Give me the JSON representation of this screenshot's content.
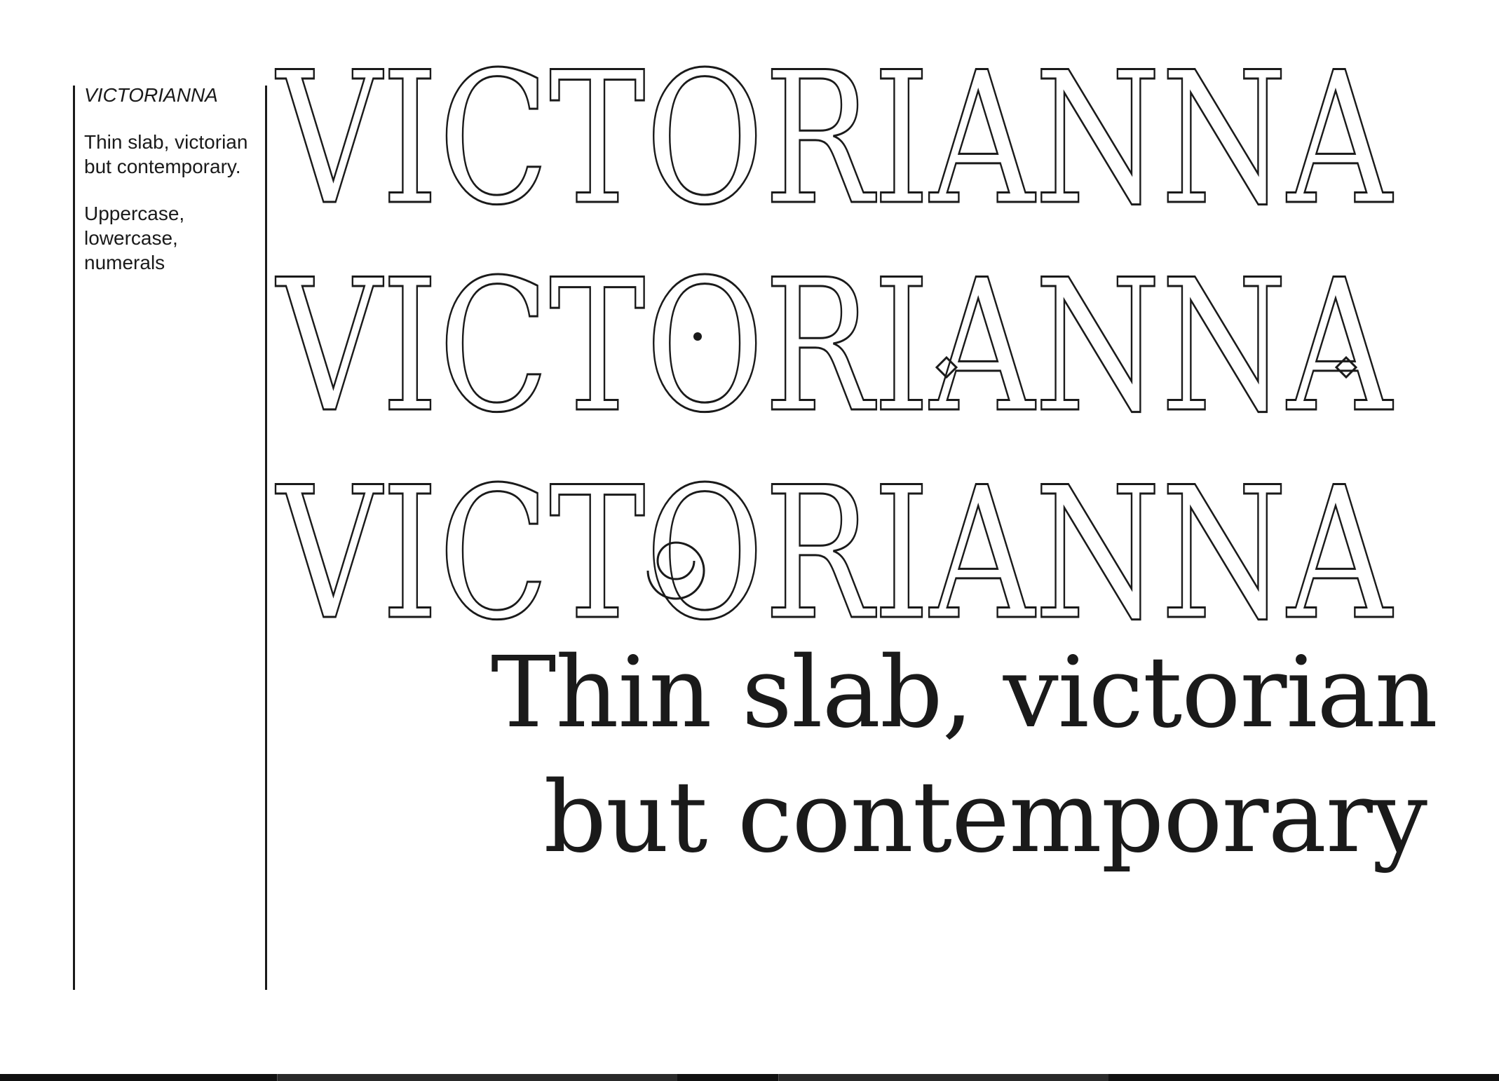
{
  "sidebar": {
    "font_name": "VICTORIANNA",
    "description": "Thin slab, victorian but contemporary.",
    "features": "Uppercase, lowercase, numerals"
  },
  "specimen": {
    "uppercase_rows": [
      {
        "text": "VICTORIANNA"
      },
      {
        "text": "VICTORIANNA"
      },
      {
        "text": "VICTORIANNA"
      }
    ],
    "sample_lines": [
      "Thin slab, victorian",
      "but contemporary"
    ]
  },
  "colors": {
    "ink": "#1a1a1a",
    "background": "#ffffff",
    "taskbar": "#111111"
  }
}
